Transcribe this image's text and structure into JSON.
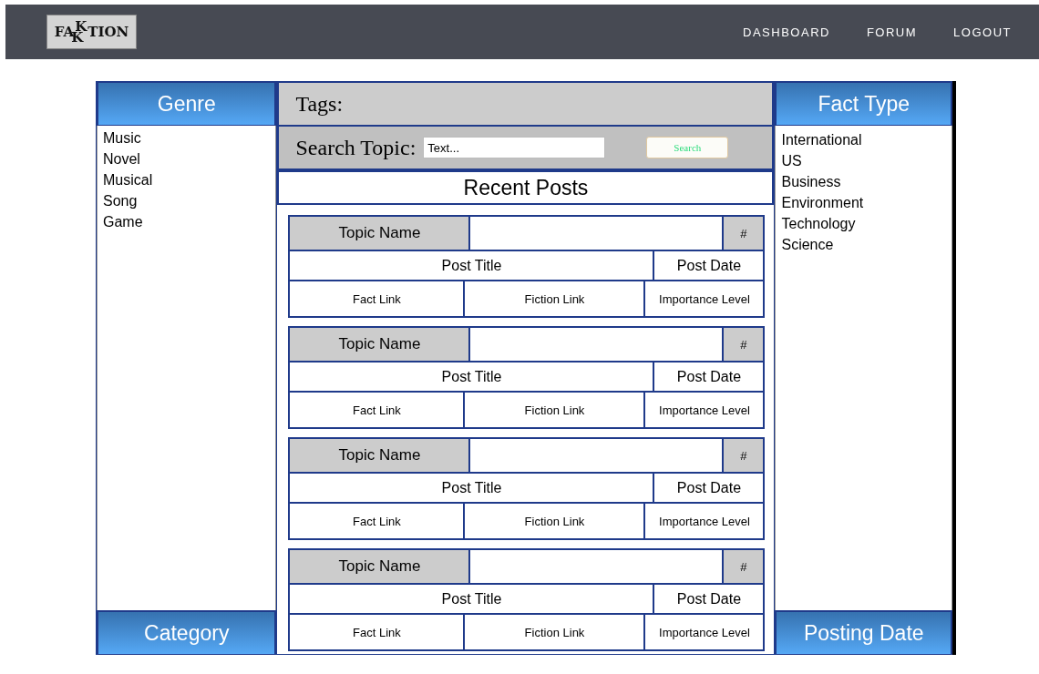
{
  "header": {
    "logo": {
      "left": "FA",
      "upper": "K",
      "lower": "K",
      "right": "TION"
    },
    "nav": [
      "DASHBOARD",
      "FORUM",
      "LOGOUT"
    ]
  },
  "left_panel": {
    "title": "Genre",
    "items": [
      "Music",
      "Novel",
      "Musical",
      "Song",
      "Game"
    ],
    "footer": "Category"
  },
  "center": {
    "tags_label": "Tags:",
    "search": {
      "label": "Search Topic:",
      "placeholder": "Text...",
      "button": "Search"
    },
    "heading": "Recent Posts",
    "posts": [
      {
        "topic": "Topic Name",
        "number": "#",
        "title": "Post Title",
        "date": "Post Date",
        "fact": "Fact Link",
        "fiction": "Fiction Link",
        "importance": "Importance Level"
      },
      {
        "topic": "Topic Name",
        "number": "#",
        "title": "Post Title",
        "date": "Post Date",
        "fact": "Fact Link",
        "fiction": "Fiction Link",
        "importance": "Importance Level"
      },
      {
        "topic": "Topic Name",
        "number": "#",
        "title": "Post Title",
        "date": "Post Date",
        "fact": "Fact Link",
        "fiction": "Fiction Link",
        "importance": "Importance Level"
      },
      {
        "topic": "Topic Name",
        "number": "#",
        "title": "Post Title",
        "date": "Post Date",
        "fact": "Fact Link",
        "fiction": "Fiction Link",
        "importance": "Importance Level"
      }
    ]
  },
  "right_panel": {
    "title": "Fact Type",
    "items": [
      "International",
      "US",
      "Business",
      "Environment",
      "Technology",
      "Science"
    ],
    "footer": "Posting Date"
  }
}
